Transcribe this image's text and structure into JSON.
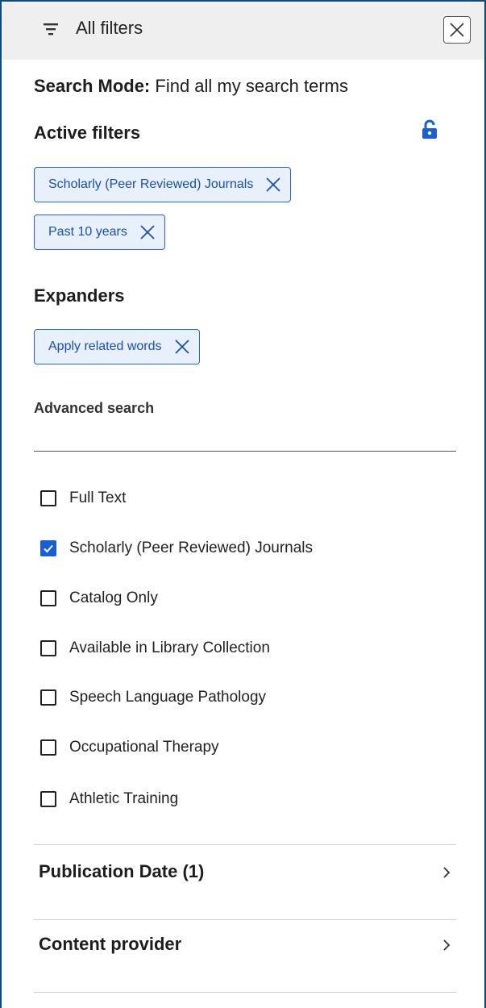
{
  "header": {
    "title": "All filters",
    "filter_icon": "filter-lines-icon",
    "close_icon": "close-icon"
  },
  "search_mode": {
    "label": "Search Mode:",
    "value": " Find all my search terms"
  },
  "active_filters": {
    "title": "Active filters",
    "lock_icon": "unlocked-padlock-icon",
    "chips": [
      {
        "label": "Scholarly (Peer Reviewed) Journals"
      },
      {
        "label": "Past 10 years"
      }
    ]
  },
  "expanders": {
    "title": "Expanders",
    "chips": [
      {
        "label": "Apply related words"
      }
    ]
  },
  "advanced_search": {
    "title": "Advanced search"
  },
  "limiters": [
    {
      "label": "Full Text",
      "checked": false
    },
    {
      "label": "Scholarly (Peer Reviewed) Journals",
      "checked": true
    },
    {
      "label": "Catalog Only",
      "checked": false
    },
    {
      "label": "Available in Library Collection",
      "checked": false
    },
    {
      "label": "Speech Language Pathology",
      "checked": false
    },
    {
      "label": "Occupational Therapy",
      "checked": false
    },
    {
      "label": "Athletic Training",
      "checked": false
    }
  ],
  "accordions": [
    {
      "label": "Publication Date (1)"
    },
    {
      "label": "Content provider"
    }
  ],
  "colors": {
    "accent": "#1a5fd0",
    "chip_bg": "#e8f0fb",
    "chip_border": "#2a64c8",
    "frame": "#0d4a7a",
    "header_bg": "#efefef"
  }
}
